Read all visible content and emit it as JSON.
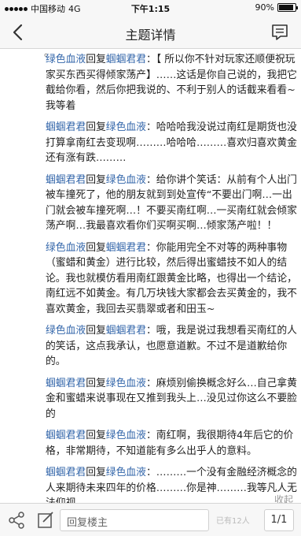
{
  "status_bar": {
    "carrier": "中国移动",
    "network": "4G",
    "time": "下午1:15",
    "battery_text": "90%",
    "battery_level": 0.9
  },
  "nav": {
    "title": "主题详情",
    "back_icon": "chevron-left-icon",
    "menu_icon": "message-menu-icon"
  },
  "content": {
    "top_fragment": "。",
    "reply_word": "回复",
    "replies": [
      {
        "from": "绿色血液",
        "to": "蝈蝈君君",
        "text": "：【 所以你不针对玩家还顺便祝玩家买东西买得倾家荡产】……这话是你自己说的，我把它截给你看，然后你把我说的、不利于别人的话截来看看~我等着"
      },
      {
        "from": "蝈蝈君君",
        "to": "绿色血液",
        "text": "：哈哈哈我没说过南红是期货也没打算拿南红去变现啊………哈哈哈………喜欢归喜欢黄金还有涨有跌………"
      },
      {
        "from": "蝈蝈君君",
        "to": "绿色血液",
        "text": "：给你讲个笑话：从前有个人出门被车撞死了，他的朋友就到到处宣传“不要出门啊…一出门就会被车撞死啊…！不要买南红啊…一买南红就会倾家荡产啊…我最喜欢看你们买啊买啊…倾家荡产啦！！"
      },
      {
        "from": "绿色血液",
        "to": "蝈蝈君君",
        "text": "：你能用完全不对等的两种事物（蜜蜡和黄金）进行比较，然后得出蜜蜡技不如人的结论。我也就模仿看用南红跟黄金比略，也得出一个结论，南红远不如黄金。有几万块钱大家都会去买黄金的，我不喜欢黄金，我回去买翡翠或者和田玉~"
      },
      {
        "from": "绿色血液",
        "to": "蝈蝈君君",
        "text": "：哦，我是说过我想看买南红的人的笑话，这点我承认，也愿意道歉。不过不是道歉给你的。"
      },
      {
        "from": "蝈蝈君君",
        "to": "绿色血液",
        "text": "：麻烦别偷换概念好么…自己拿黄金和蜜蜡来说事现在又推到我头上…没见过你这么不要脸的"
      },
      {
        "from": "蝈蝈君君",
        "to": "绿色血液",
        "text": "：南红啊，我很期待4年后它的价格，非常期待，不知道能有多么出乎人的意料。"
      },
      {
        "from": "蝈蝈君君",
        "to": "绿色血液",
        "text": "：………一个没有金融经济概念的人来期待未来四年的价格………你是神………我等凡人无法仰视………"
      }
    ],
    "fold_label": "收起"
  },
  "bottom_bar": {
    "share_icon": "share-icon",
    "edit_icon": "edit-icon",
    "reply_placeholder": "回复楼主",
    "page_info": "已有12人",
    "page_button": "1/1"
  },
  "colors": {
    "username": "#3366aa",
    "background": "#f2f2f2",
    "content_bg": "#ffffff",
    "bar_bg": "#f7f7f7"
  }
}
